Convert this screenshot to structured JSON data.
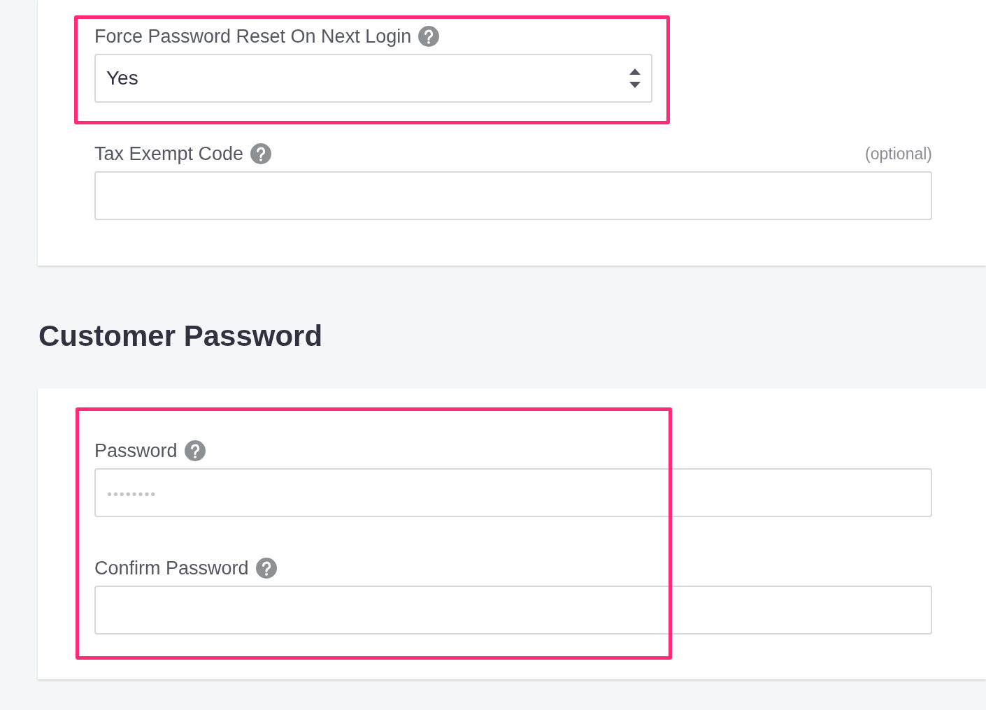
{
  "sections": [
    {
      "groups": [
        {
          "highlighted": true,
          "fields": [
            {
              "kind": "select",
              "label": "Force Password Reset On Next Login",
              "help": true,
              "value": "Yes"
            }
          ]
        },
        {
          "highlighted": false,
          "fields": [
            {
              "kind": "text",
              "label": "Tax Exempt Code",
              "help": true,
              "optional_note": "(optional)"
            }
          ]
        }
      ]
    },
    {
      "title": "Customer Password",
      "groups": [
        {
          "highlighted": true,
          "fields": [
            {
              "kind": "password",
              "label": "Password",
              "help": true,
              "placeholder": "••••••••"
            },
            {
              "kind": "password",
              "label": "Confirm Password",
              "help": true
            }
          ]
        }
      ]
    }
  ]
}
